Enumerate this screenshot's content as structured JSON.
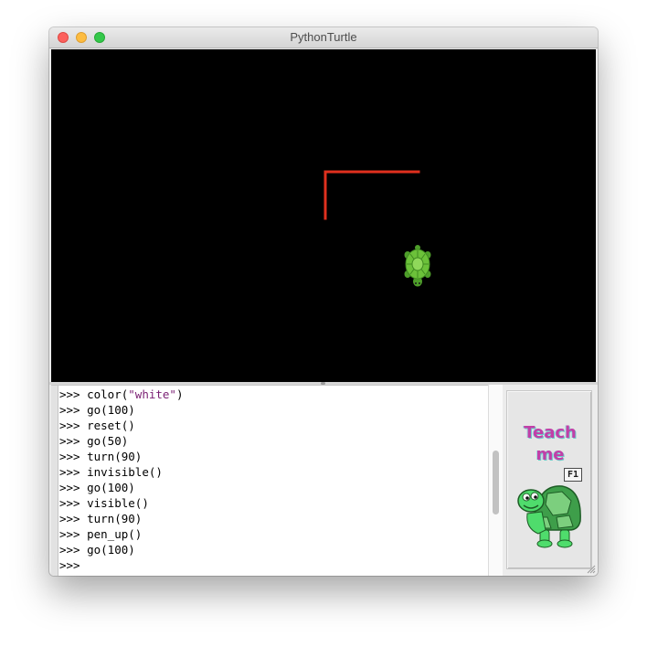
{
  "window": {
    "title": "PythonTurtle"
  },
  "colors": {
    "canvas_background": "#000000",
    "drawn_line": "#e0301e",
    "turtle_shell": "#6cc13a",
    "string_literal": "#7a1f73",
    "teach_text": "#c23fa8"
  },
  "shell": {
    "prompt": ">>>",
    "history": [
      {
        "prefix": "color(",
        "string": "\"white\"",
        "suffix": ")"
      },
      {
        "prefix": "go(100)",
        "string": "",
        "suffix": ""
      },
      {
        "prefix": "reset()",
        "string": "",
        "suffix": ""
      },
      {
        "prefix": "go(50)",
        "string": "",
        "suffix": ""
      },
      {
        "prefix": "turn(90)",
        "string": "",
        "suffix": ""
      },
      {
        "prefix": "invisible()",
        "string": "",
        "suffix": ""
      },
      {
        "prefix": "go(100)",
        "string": "",
        "suffix": ""
      },
      {
        "prefix": "visible()",
        "string": "",
        "suffix": ""
      },
      {
        "prefix": "turn(90)",
        "string": "",
        "suffix": ""
      },
      {
        "prefix": "pen_up()",
        "string": "",
        "suffix": ""
      },
      {
        "prefix": "go(100)",
        "string": "",
        "suffix": ""
      }
    ],
    "current_input": ""
  },
  "teach_me": {
    "line1": "Teach",
    "line2": "me",
    "key": "F1"
  }
}
